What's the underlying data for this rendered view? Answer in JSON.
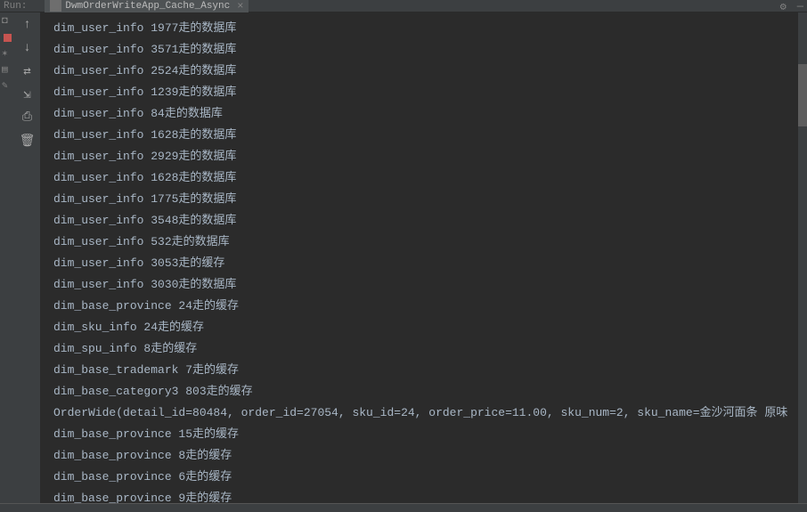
{
  "header": {
    "run_label": "Run:",
    "tab_title": "DwmOrderWriteApp_Cache_Async"
  },
  "icons": {
    "gear": "gear-icon",
    "minimize": "minimize-icon",
    "close_tab": "close-icon",
    "app_icon": "app-icon"
  },
  "toolbar": {
    "items": [
      {
        "name": "rerun-icon",
        "glyph": "↑"
      },
      {
        "name": "step-down-icon",
        "glyph": "↓"
      },
      {
        "name": "wrap-icon",
        "glyph": "⇄"
      },
      {
        "name": "scroll-end-icon",
        "glyph": "⇲"
      },
      {
        "name": "print-icon",
        "glyph": "⎙"
      },
      {
        "name": "trash-icon",
        "glyph": "🗑"
      }
    ]
  },
  "gutter": [
    {
      "name": "camera-icon",
      "glyph": "📷"
    },
    {
      "name": "red-stop",
      "glyph": ""
    },
    {
      "name": "bug-icon",
      "glyph": "🐞"
    },
    {
      "name": "marker-icon",
      "glyph": "✎"
    },
    {
      "name": "structure-icon",
      "glyph": "▤"
    }
  ],
  "console_lines": [
    "dim_user_info 1977走的数据库",
    "dim_user_info 3571走的数据库",
    "dim_user_info 2524走的数据库",
    "dim_user_info 1239走的数据库",
    "dim_user_info 84走的数据库",
    "dim_user_info 1628走的数据库",
    "dim_user_info 2929走的数据库",
    "dim_user_info 1628走的数据库",
    "dim_user_info 1775走的数据库",
    "dim_user_info 3548走的数据库",
    "dim_user_info 532走的数据库",
    "dim_user_info 3053走的缓存",
    "dim_user_info 3030走的数据库",
    "dim_base_province 24走的缓存",
    "dim_sku_info 24走的缓存",
    "dim_spu_info 8走的缓存",
    "dim_base_trademark 7走的缓存",
    "dim_base_category3 803走的缓存",
    "OrderWide(detail_id=80484, order_id=27054, sku_id=24, order_price=11.00, sku_num=2, sku_name=金沙河面条 原味",
    "dim_base_province 15走的缓存",
    "dim_base_province 8走的缓存",
    "dim_base_province 6走的缓存",
    "dim_base_province 9走的缓存"
  ]
}
